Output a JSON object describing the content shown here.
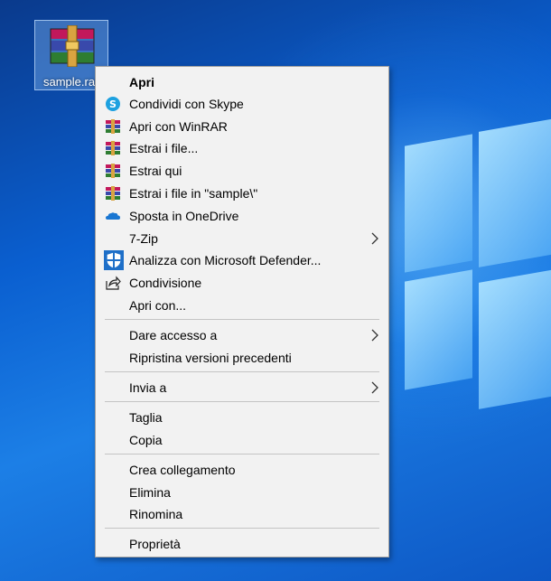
{
  "desktop": {
    "file_label": "sample.rar",
    "file_icon": "winrar-archive-icon"
  },
  "menu": {
    "items": [
      {
        "label": "Apri",
        "icon": "",
        "default": true
      },
      {
        "label": "Condividi con Skype",
        "icon": "skype-icon"
      },
      {
        "label": "Apri con WinRAR",
        "icon": "winrar-icon"
      },
      {
        "label": "Estrai i file...",
        "icon": "winrar-icon"
      },
      {
        "label": "Estrai qui",
        "icon": "winrar-icon"
      },
      {
        "label": "Estrai i file in \"sample\\\"",
        "icon": "winrar-icon"
      },
      {
        "label": "Sposta in OneDrive",
        "icon": "onedrive-icon"
      },
      {
        "label": "7-Zip",
        "icon": "",
        "submenu": true
      },
      {
        "label": "Analizza con Microsoft Defender...",
        "icon": "defender-shield-icon"
      },
      {
        "label": "Condivisione",
        "icon": "share-icon"
      },
      {
        "label": "Apri con...",
        "icon": ""
      },
      {
        "label": "Dare accesso a",
        "icon": "",
        "submenu": true
      },
      {
        "label": "Ripristina versioni precedenti",
        "icon": ""
      },
      {
        "label": "Invia a",
        "icon": "",
        "submenu": true
      },
      {
        "label": "Taglia",
        "icon": ""
      },
      {
        "label": "Copia",
        "icon": ""
      },
      {
        "label": "Crea collegamento",
        "icon": ""
      },
      {
        "label": "Elimina",
        "icon": ""
      },
      {
        "label": "Rinomina",
        "icon": ""
      },
      {
        "label": "Proprietà",
        "icon": ""
      }
    ]
  },
  "colors": {
    "menu_bg": "#f2f2f2",
    "separator": "#c4c4c4",
    "desktop_accent": "#0a5fd0"
  }
}
